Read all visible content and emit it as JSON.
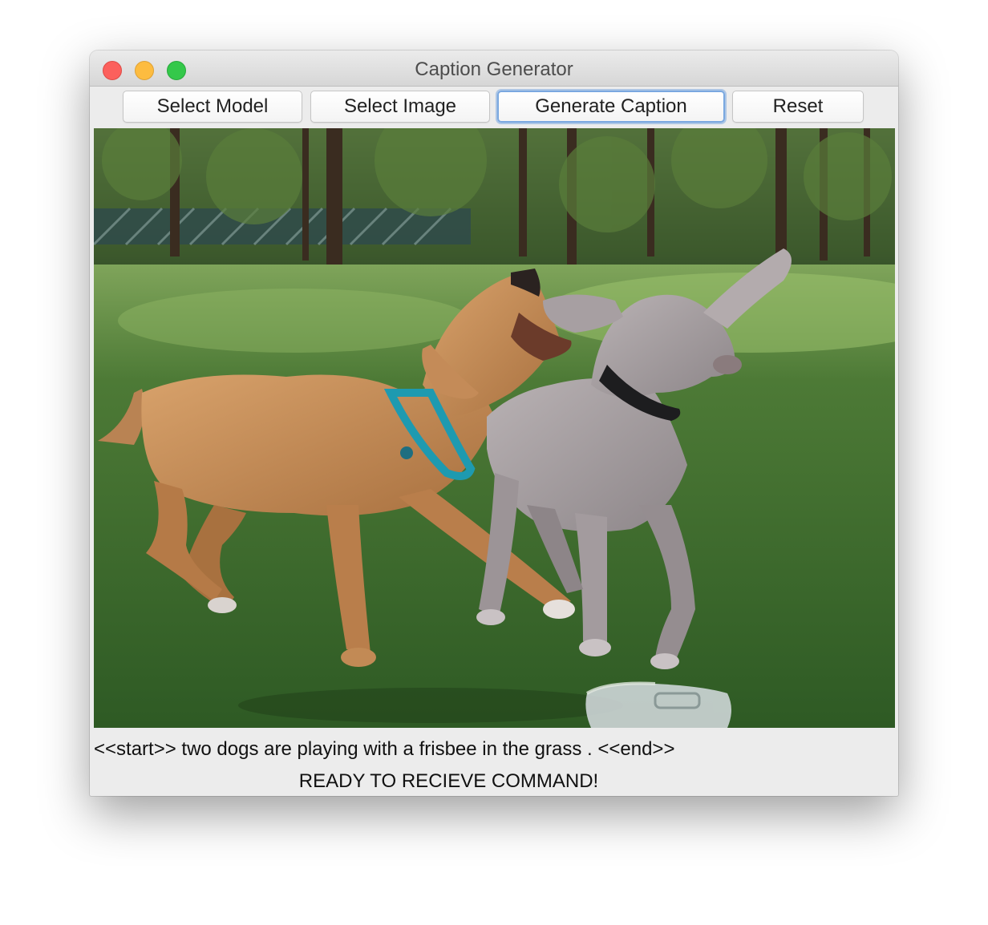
{
  "window": {
    "title": "Caption Generator"
  },
  "toolbar": {
    "select_model_label": "Select Model",
    "select_image_label": "Select Image",
    "generate_caption_label": "Generate Caption",
    "reset_label": "Reset"
  },
  "image": {
    "description_icon": "photo-two-dogs-playing-in-grass"
  },
  "caption": {
    "text": "<<start>> two dogs are playing with a frisbee in the grass . <<end>>"
  },
  "status": {
    "text": "READY TO RECIEVE COMMAND!"
  },
  "colors": {
    "close": "#fc605c",
    "minimize": "#fdbc40",
    "zoom": "#34c84a",
    "focus_ring": "#7aa8e0"
  }
}
